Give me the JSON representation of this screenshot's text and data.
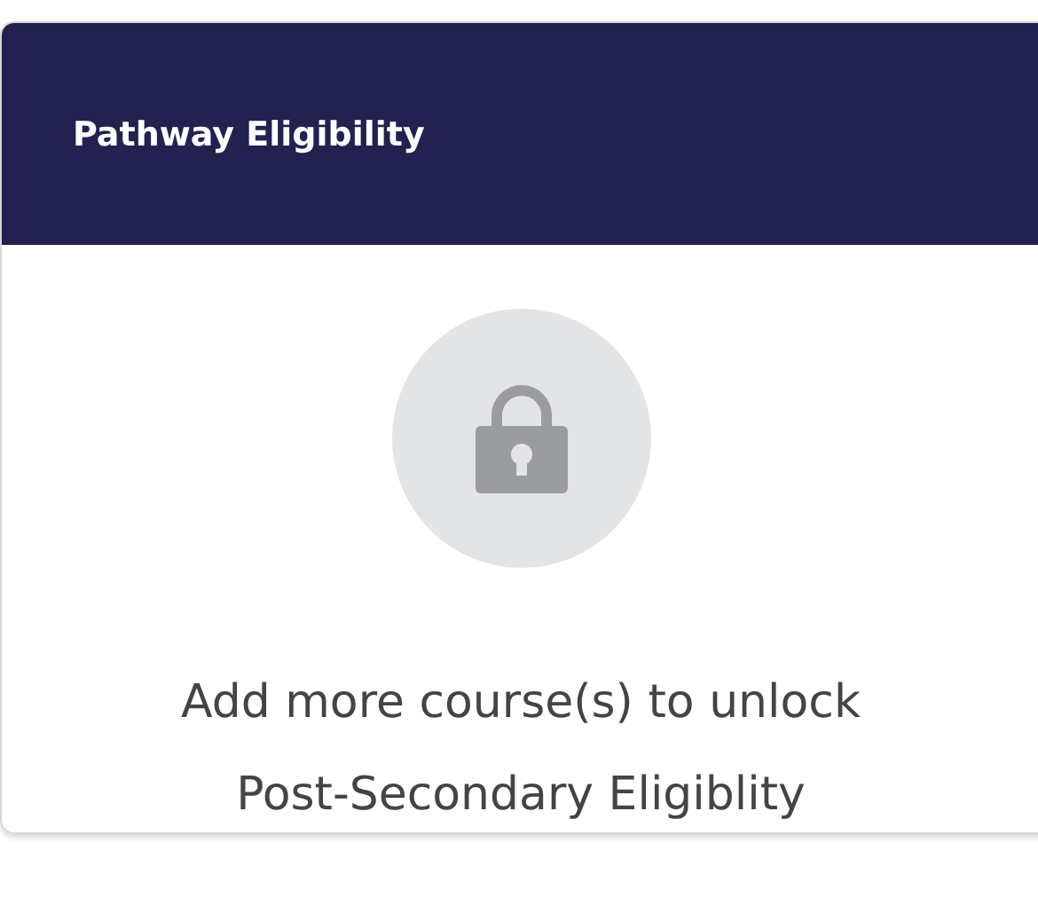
{
  "card": {
    "title": "Pathway Eligibility",
    "message_lines": [
      "Add more course(s) to unlock",
      "Post-Secondary Eligiblity"
    ]
  }
}
